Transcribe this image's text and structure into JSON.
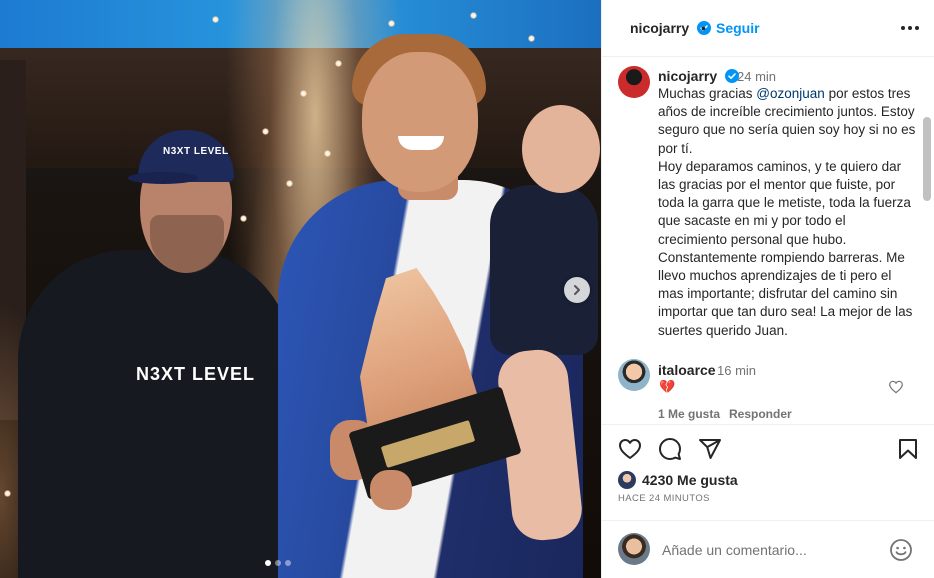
{
  "post": {
    "username": "nicojarry",
    "follow_label": "Seguir",
    "separator": "•",
    "carousel": {
      "current_index": 0,
      "total": 3
    }
  },
  "caption": {
    "username": "nicojarry",
    "time": "24 min",
    "text_before_mention": "Muchas gracias ",
    "mention": "@ozonjuan",
    "text_after_mention": " por estos tres años de increíble crecimiento juntos. Estoy seguro que no sería quien soy hoy si no es por tí.\nHoy deparamos caminos, y te quiero dar las gracias por el mentor que fuiste, por toda la garra que le metiste, toda la fuerza que sacaste en mi y por todo el crecimiento personal que hubo. Constantemente rompiendo barreras. Me llevo muchos aprendizajes de ti pero el mas importante; disfrutar del camino sin importar que tan duro sea! La mejor de las suertes querido Juan."
  },
  "comments": [
    {
      "username": "italoarce",
      "time": "16 min",
      "text": "💔",
      "likes_label": "1 Me gusta",
      "reply_label": "Responder"
    }
  ],
  "engagement": {
    "likes_label": "4230 Me gusta",
    "posted_label": "HACE 24 MINUTOS"
  },
  "add_comment": {
    "placeholder": "Añade un comentario..."
  },
  "photo_text": {
    "cap_logo": "N3XT LEVEL",
    "shirt_logo": "N3XT LEVEL"
  },
  "colors": {
    "accent": "#0095f6",
    "mention": "#00376b",
    "muted": "#737373",
    "text": "#262626",
    "heart_emoji": "#b9202f"
  },
  "icons": [
    "verified-icon",
    "more-options-icon",
    "chevron-right-icon",
    "heart-outline-icon",
    "comment-icon",
    "share-icon",
    "bookmark-icon",
    "emoji-icon"
  ]
}
